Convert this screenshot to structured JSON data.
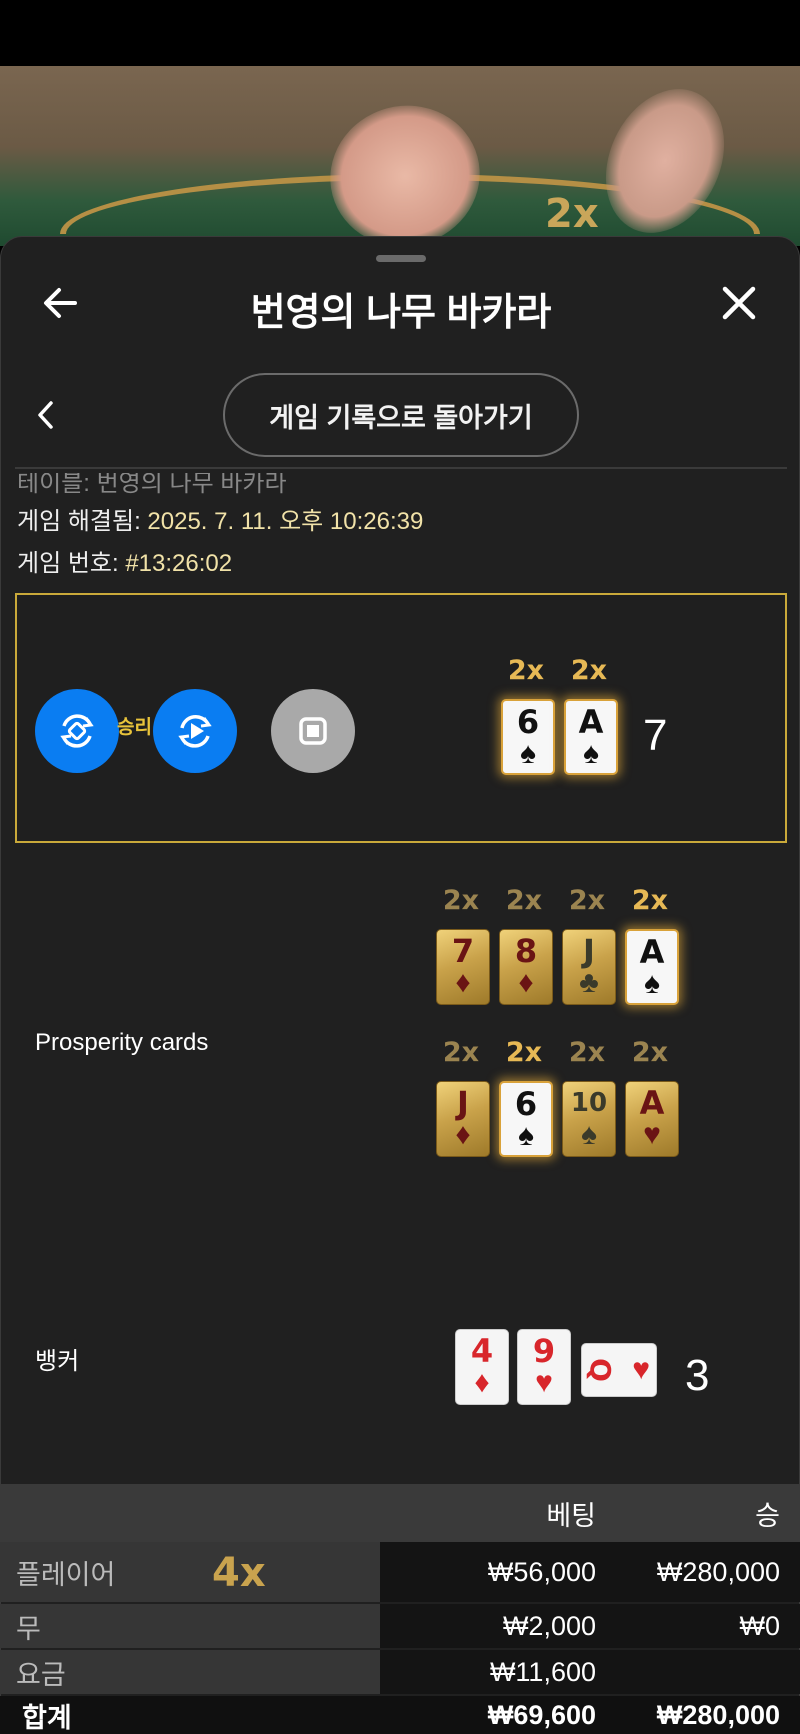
{
  "video": {
    "table_multiplier": "2x"
  },
  "header": {
    "title": "번영의 나무 바카라"
  },
  "subnav": {
    "back_to_history": "게임 기록으로 돌아가기"
  },
  "info": {
    "table_line": "테이블: 번영의 나무 바카라",
    "resolved_label": "게임 해결됨: ",
    "resolved_value": "2025. 7. 11. 오후 10:26:39",
    "game_no_label": "게임 번호: ",
    "game_no_value": "#13:26:02"
  },
  "player": {
    "win_label": "승리",
    "cards": [
      {
        "rank": "6",
        "suit": "♠",
        "multiplier": "2x"
      },
      {
        "rank": "A",
        "suit": "♠",
        "multiplier": "2x"
      }
    ],
    "score": "7"
  },
  "prosperity": {
    "label": "Prosperity cards",
    "row1": [
      {
        "rank": "7",
        "suit": "♦",
        "multiplier": "2x",
        "active": false
      },
      {
        "rank": "8",
        "suit": "♦",
        "multiplier": "2x",
        "active": false
      },
      {
        "rank": "J",
        "suit": "♣",
        "multiplier": "2x",
        "active": false
      },
      {
        "rank": "A",
        "suit": "♠",
        "multiplier": "2x",
        "active": true
      }
    ],
    "row2": [
      {
        "rank": "J",
        "suit": "♦",
        "multiplier": "2x",
        "active": false
      },
      {
        "rank": "6",
        "suit": "♠",
        "multiplier": "2x",
        "active": true
      },
      {
        "rank": "10",
        "suit": "♠",
        "multiplier": "2x",
        "active": false
      },
      {
        "rank": "A",
        "suit": "♥",
        "multiplier": "2x",
        "active": false
      }
    ]
  },
  "banker": {
    "label": "뱅커",
    "cards": [
      {
        "rank": "4",
        "suit": "♦"
      },
      {
        "rank": "9",
        "suit": "♥"
      },
      {
        "rank": "Q",
        "suit": "♥"
      }
    ],
    "score": "3"
  },
  "table": {
    "headers": {
      "bet": "베팅",
      "win": "승"
    },
    "rows": [
      {
        "label": "플레이어",
        "multiplier": "4x",
        "bet": "₩56,000",
        "win": "₩280,000"
      },
      {
        "label": "무",
        "bet": "₩2,000",
        "win": "₩0"
      },
      {
        "label": "요금",
        "bet": "₩11,600",
        "win": ""
      },
      {
        "label": "합계",
        "bet": "₩69,600",
        "win": "₩280,000"
      }
    ]
  },
  "colors": {
    "accent_gold": "#e7b955",
    "button_blue": "#0a7df2",
    "border_gold": "#c9a93a"
  }
}
